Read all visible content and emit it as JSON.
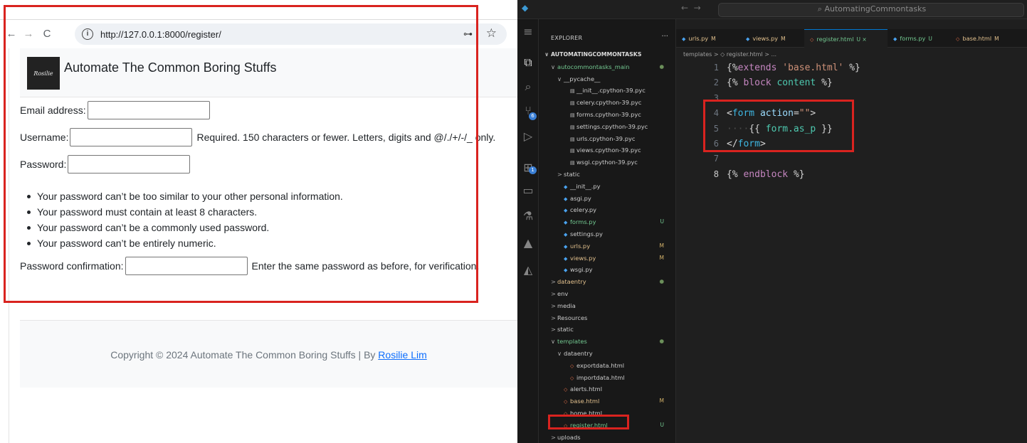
{
  "browser": {
    "url": "http://127.0.0.1:8000/register/",
    "nav": {
      "back": "←",
      "forward": "→",
      "reload": "C"
    },
    "site_title": "Automate The Common Boring Stuffs",
    "logo_text": "Rosilie",
    "form": {
      "email_label": "Email address:",
      "username_label": "Username:",
      "username_help": "Required. 150 characters or fewer. Letters, digits and @/./+/-/_ only.",
      "password_label": "Password:",
      "password_rules": [
        "Your password can’t be too similar to your other personal information.",
        "Your password must contain at least 8 characters.",
        "Your password can’t be a commonly used password.",
        "Your password can’t be entirely numeric."
      ],
      "password_confirm_label": "Password confirmation:",
      "password_confirm_help": "Enter the same password as before, for verification."
    },
    "footer": {
      "text": "Copyright © 2024 Automate The Common Boring Stuffs | By ",
      "link": "Rosilie Lim"
    }
  },
  "vscode": {
    "command_center": "AutomatingCommontasks",
    "explorer_title": "EXPLORER",
    "explorer_more": "···",
    "tabs": [
      {
        "label": "urls.py",
        "mark": "M",
        "icon": "python-icon"
      },
      {
        "label": "views.py",
        "mark": "M",
        "icon": "python-icon"
      },
      {
        "label": "register.html",
        "mark": "U ×",
        "icon": "html-icon"
      },
      {
        "label": "forms.py",
        "mark": "U",
        "icon": "python-icon"
      },
      {
        "label": "base.html",
        "mark": "M",
        "icon": "html-icon"
      }
    ],
    "breadcrumb": "templates > ◇ register.html > ...",
    "tree": [
      {
        "label": "AUTOMATINGCOMMONTASKS",
        "indent": 0,
        "chev": "∨",
        "icon": "",
        "status": "",
        "kind": "root"
      },
      {
        "label": "autocommontasks_main",
        "indent": 1,
        "chev": "∨",
        "icon": "",
        "status": "●",
        "kind": "folder-green"
      },
      {
        "label": "__pycache__",
        "indent": 2,
        "chev": "∨",
        "icon": "",
        "status": "",
        "kind": "folder"
      },
      {
        "label": "__init__.cpython-39.pyc",
        "indent": 3,
        "chev": "",
        "icon": "pyc",
        "status": "",
        "kind": "file"
      },
      {
        "label": "celery.cpython-39.pyc",
        "indent": 3,
        "chev": "",
        "icon": "pyc",
        "status": "",
        "kind": "file"
      },
      {
        "label": "forms.cpython-39.pyc",
        "indent": 3,
        "chev": "",
        "icon": "pyc",
        "status": "",
        "kind": "file"
      },
      {
        "label": "settings.cpython-39.pyc",
        "indent": 3,
        "chev": "",
        "icon": "pyc",
        "status": "",
        "kind": "file"
      },
      {
        "label": "urls.cpython-39.pyc",
        "indent": 3,
        "chev": "",
        "icon": "pyc",
        "status": "",
        "kind": "file"
      },
      {
        "label": "views.cpython-39.pyc",
        "indent": 3,
        "chev": "",
        "icon": "pyc",
        "status": "",
        "kind": "file"
      },
      {
        "label": "wsgi.cpython-39.pyc",
        "indent": 3,
        "chev": "",
        "icon": "pyc",
        "status": "",
        "kind": "file"
      },
      {
        "label": "static",
        "indent": 2,
        "chev": ">",
        "icon": "",
        "status": "",
        "kind": "folder"
      },
      {
        "label": "__init__.py",
        "indent": 2,
        "chev": "",
        "icon": "py",
        "status": "",
        "kind": "file"
      },
      {
        "label": "asgi.py",
        "indent": 2,
        "chev": "",
        "icon": "py",
        "status": "",
        "kind": "file"
      },
      {
        "label": "celery.py",
        "indent": 2,
        "chev": "",
        "icon": "py",
        "status": "",
        "kind": "file"
      },
      {
        "label": "forms.py",
        "indent": 2,
        "chev": "",
        "icon": "py",
        "status": "U",
        "kind": "untracked"
      },
      {
        "label": "settings.py",
        "indent": 2,
        "chev": "",
        "icon": "py",
        "status": "",
        "kind": "file"
      },
      {
        "label": "urls.py",
        "indent": 2,
        "chev": "",
        "icon": "py",
        "status": "M",
        "kind": "modified"
      },
      {
        "label": "views.py",
        "indent": 2,
        "chev": "",
        "icon": "py",
        "status": "M",
        "kind": "modified"
      },
      {
        "label": "wsgi.py",
        "indent": 2,
        "chev": "",
        "icon": "py",
        "status": "",
        "kind": "file"
      },
      {
        "label": "dataentry",
        "indent": 1,
        "chev": ">",
        "icon": "",
        "status": "●",
        "kind": "folder-modified"
      },
      {
        "label": "env",
        "indent": 1,
        "chev": ">",
        "icon": "",
        "status": "",
        "kind": "folder"
      },
      {
        "label": "media",
        "indent": 1,
        "chev": ">",
        "icon": "",
        "status": "",
        "kind": "folder"
      },
      {
        "label": "Resources",
        "indent": 1,
        "chev": ">",
        "icon": "",
        "status": "",
        "kind": "folder"
      },
      {
        "label": "static",
        "indent": 1,
        "chev": ">",
        "icon": "",
        "status": "",
        "kind": "folder"
      },
      {
        "label": "templates",
        "indent": 1,
        "chev": "∨",
        "icon": "",
        "status": "●",
        "kind": "folder-green"
      },
      {
        "label": "dataentry",
        "indent": 2,
        "chev": "∨",
        "icon": "",
        "status": "",
        "kind": "folder"
      },
      {
        "label": "exportdata.html",
        "indent": 3,
        "chev": "",
        "icon": "html",
        "status": "",
        "kind": "file"
      },
      {
        "label": "importdata.html",
        "indent": 3,
        "chev": "",
        "icon": "html",
        "status": "",
        "kind": "file"
      },
      {
        "label": "alerts.html",
        "indent": 2,
        "chev": "",
        "icon": "html",
        "status": "",
        "kind": "file"
      },
      {
        "label": "base.html",
        "indent": 2,
        "chev": "",
        "icon": "html",
        "status": "M",
        "kind": "modified"
      },
      {
        "label": "home.html",
        "indent": 2,
        "chev": "",
        "icon": "html",
        "status": "",
        "kind": "file"
      },
      {
        "label": "register.html",
        "indent": 2,
        "chev": "",
        "icon": "html",
        "status": "U",
        "kind": "untracked"
      },
      {
        "label": "uploads",
        "indent": 1,
        "chev": ">",
        "icon": "",
        "status": "",
        "kind": "folder"
      }
    ],
    "code_lines": [
      {
        "num": "1",
        "html": "{%extends 'base.html' %}"
      },
      {
        "num": "2",
        "html": "{% block content %}"
      },
      {
        "num": "3",
        "html": ""
      },
      {
        "num": "4",
        "html": "<form action=\"\">"
      },
      {
        "num": "5",
        "html": "    {{ form.as_p }}"
      },
      {
        "num": "6",
        "html": "</form>"
      },
      {
        "num": "7",
        "html": ""
      },
      {
        "num": "8",
        "html": "{% endblock %}"
      }
    ]
  },
  "colors": {
    "highlight": "#d9231f",
    "link": "#0d6efd",
    "vscode_bg": "#1e1e1e"
  }
}
